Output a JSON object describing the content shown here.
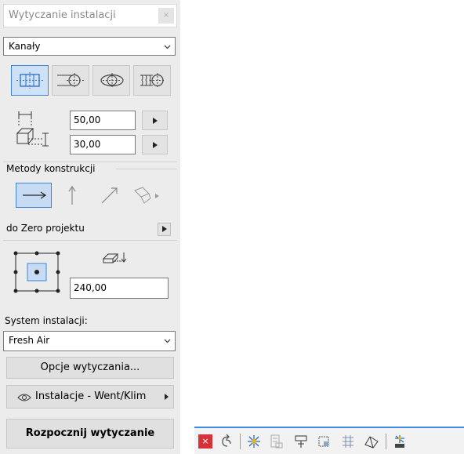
{
  "panel": {
    "title": "Wytyczanie instalacji",
    "close_glyph": "×",
    "domain_select": {
      "value": "Kanały"
    },
    "geometry_buttons": [
      {
        "name": "rectangular-duct-icon",
        "active": true
      },
      {
        "name": "round-rect-duct-icon",
        "active": false
      },
      {
        "name": "round-duct-icon",
        "active": false
      },
      {
        "name": "flex-duct-icon",
        "active": false
      }
    ],
    "width_value": "50,00",
    "height_value": "30,00",
    "methods_label": "Metody konstrukcji",
    "methods": [
      {
        "name": "horizontal-method-icon",
        "active": true
      },
      {
        "name": "vertical-method-icon",
        "active": false
      },
      {
        "name": "slanted-method-icon",
        "active": false
      },
      {
        "name": "custom-method-icon",
        "active": false
      }
    ],
    "reference_label": "do Zero projektu",
    "elevation_value": "240,00",
    "system_label": "System instalacji:",
    "system_select": {
      "value": "Fresh Air"
    },
    "routing_options_label": "Opcje wytyczania...",
    "layer_label": "Instalacje - Went/Klim",
    "start_label": "Rozpocznij wytyczanie"
  },
  "toolbar": {
    "icons": [
      "close-routing-icon",
      "undo-routing-icon",
      "separator",
      "snap-icon",
      "segment-icon",
      "fitting-icon",
      "elbow-icon",
      "transition-icon",
      "slope-icon",
      "separator",
      "settings-icon"
    ]
  },
  "colors": {
    "accent_blue": "#3d86d6",
    "active_fill": "#cfe1f6",
    "panel_bg": "#ececec",
    "close_red": "#d6323a"
  }
}
